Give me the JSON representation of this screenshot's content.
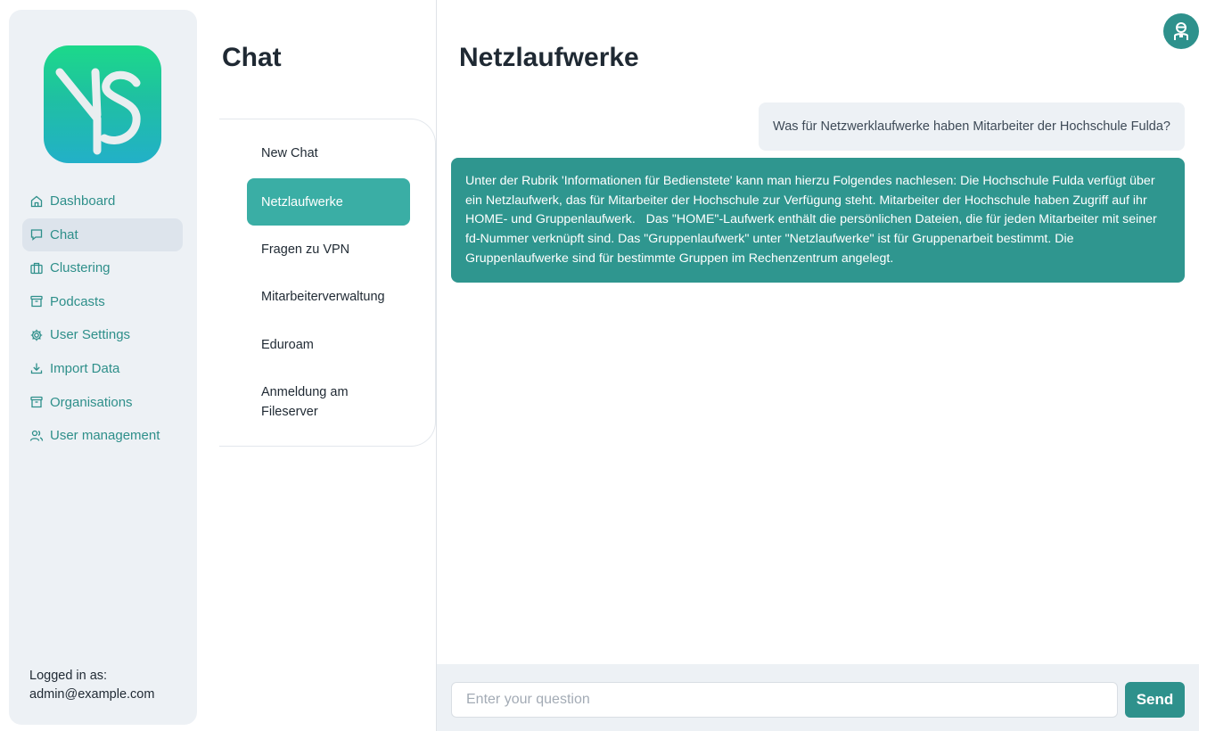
{
  "brand": {
    "logo_text": "YS",
    "logo_gradient": [
      "#1cd98a",
      "#22b0c8"
    ]
  },
  "sidebar": {
    "items": [
      {
        "label": "Dashboard",
        "icon": "home-icon"
      },
      {
        "label": "Chat",
        "icon": "chat-bubble-icon",
        "active": true
      },
      {
        "label": "Clustering",
        "icon": "briefcase-icon"
      },
      {
        "label": "Podcasts",
        "icon": "archive-icon"
      },
      {
        "label": "User Settings",
        "icon": "gear-icon"
      },
      {
        "label": "Import Data",
        "icon": "download-icon"
      },
      {
        "label": "Organisations",
        "icon": "archive-icon"
      },
      {
        "label": "User management",
        "icon": "users-icon"
      }
    ],
    "logged_in_label": "Logged in as:",
    "logged_in_user": "admin@example.com"
  },
  "chat_panel": {
    "title": "Chat",
    "chats": [
      {
        "label": "New Chat"
      },
      {
        "label": "Netzlaufwerke",
        "active": true
      },
      {
        "label": "Fragen zu VPN"
      },
      {
        "label": "Mitarbeiterverwaltung"
      },
      {
        "label": "Eduroam"
      },
      {
        "label": "Anmeldung am Fileserver"
      }
    ]
  },
  "main": {
    "title": "Netzlaufwerke",
    "messages": [
      {
        "role": "user",
        "text": "Was für Netzwerklaufwerke haben Mitarbeiter der Hochschule Fulda?"
      },
      {
        "role": "assistant",
        "text": "Unter der Rubrik 'Informationen für Bedienstete' kann man hierzu Folgendes nachlesen: Die Hochschule Fulda verfügt über ein Netzlaufwerk, das für Mitarbeiter der Hochschule zur Verfügung steht. Mitarbeiter der Hochschule haben Zugriff auf ihr HOME- und Gruppenlaufwerk.   Das \"HOME\"-Laufwerk enthält die persönlichen Dateien, die für jeden Mitarbeiter mit seiner fd-Nummer verknüpft sind. Das \"Gruppenlaufwerk\" unter \"Netzlaufwerke\" ist für Gruppenarbeit bestimmt. Die Gruppenlaufwerke sind für bestimmte Gruppen im Rechenzentrum angelegt."
      }
    ],
    "input": {
      "placeholder": "Enter your question",
      "value": ""
    },
    "send_label": "Send"
  },
  "header": {
    "avatar_icon": "user-avatar-icon"
  },
  "colors": {
    "accent": "#2e918c",
    "active_chat": "#3aaea5",
    "sidebar_bg": "#edf1f5"
  }
}
